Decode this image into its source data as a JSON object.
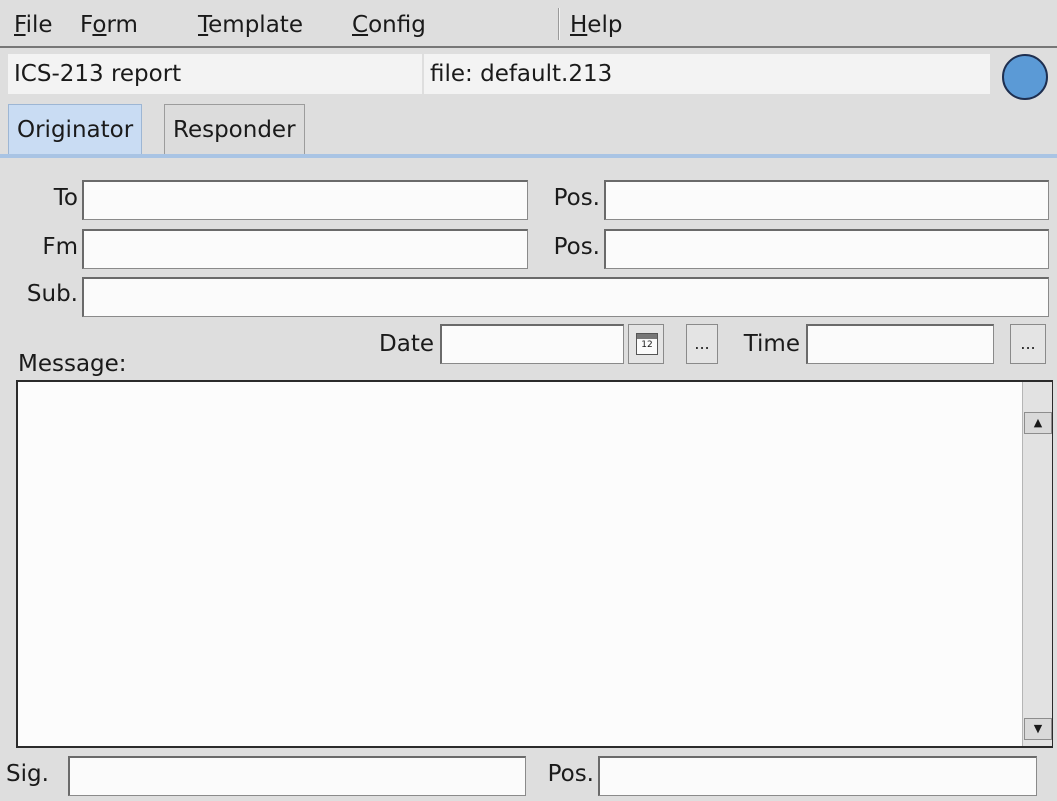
{
  "menubar": {
    "items": [
      {
        "label": "File",
        "mnemonic": "F"
      },
      {
        "label": "Form",
        "mnemonic": "o"
      },
      {
        "label": "Template",
        "mnemonic": "T"
      },
      {
        "label": "Config",
        "mnemonic": "C"
      },
      {
        "label": "Help",
        "mnemonic": "H"
      }
    ]
  },
  "title_row": {
    "report_title": "ICS-213 report",
    "file_label": "file: default.213",
    "status_color": "#5b9ad6"
  },
  "tabs": [
    {
      "label": "Originator",
      "active": true
    },
    {
      "label": "Responder",
      "active": false
    }
  ],
  "form": {
    "to_label": "To",
    "to_value": "",
    "to_pos_label": "Pos.",
    "to_pos_value": "",
    "fm_label": "Fm",
    "fm_value": "",
    "fm_pos_label": "Pos.",
    "fm_pos_value": "",
    "sub_label": "Sub.",
    "sub_value": "",
    "date_label": "Date",
    "date_value": "",
    "calendar_icon_text": "12",
    "date_more_label": "...",
    "time_label": "Time",
    "time_value": "",
    "time_more_label": "...",
    "message_label": "Message:",
    "message_value": "",
    "sig_label": "Sig.",
    "sig_value": "",
    "sig_pos_label": "Pos.",
    "sig_pos_value": ""
  },
  "icons": {
    "calendar": "calendar-icon",
    "scroll_up": "scroll-up-arrow-icon",
    "scroll_down": "scroll-down-arrow-icon"
  },
  "scroll_arrows": {
    "up": "▲",
    "down": "▼"
  }
}
